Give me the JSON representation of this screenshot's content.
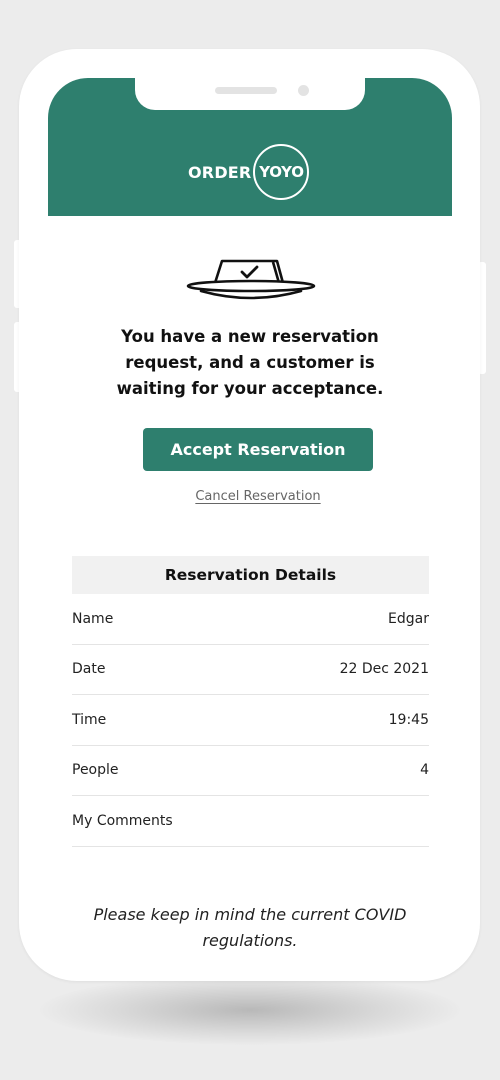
{
  "app": {
    "brand_left": "ORDER",
    "brand_right": "YOYO",
    "accent_color": "#2e7f6e"
  },
  "icons": {
    "reservation": "reservation-table-sign-icon"
  },
  "message": {
    "headline": "You have a new reservation request, and a customer is waiting for your acceptance."
  },
  "actions": {
    "accept_label": "Accept Reservation",
    "cancel_label": "Cancel Reservation"
  },
  "details": {
    "title": "Reservation Details",
    "rows": [
      {
        "label": "Name",
        "value": "Edgar"
      },
      {
        "label": "Date",
        "value": "22 Dec 2021"
      },
      {
        "label": "Time",
        "value": "19:45"
      },
      {
        "label": "People",
        "value": "4"
      },
      {
        "label": "My Comments",
        "value": ""
      }
    ]
  },
  "footer": {
    "note": "Please keep in mind the current COVID regulations."
  }
}
